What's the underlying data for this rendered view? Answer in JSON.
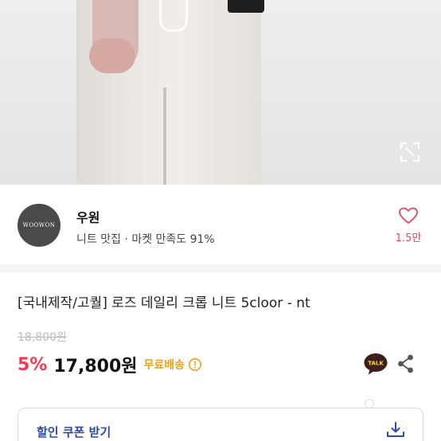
{
  "seller": {
    "avatar_text": "WOOWON",
    "name": "우원",
    "subtitle": "니트 맛집 · 마켓 만족도 91%",
    "like_count": "1.5만"
  },
  "product": {
    "title": "[국내제작/고퀄] 로즈 데일리 크롭 니트 5cloor - nt",
    "original_price": "18,800원",
    "discount": "5%",
    "price": "17,800원",
    "shipping": "무료배송"
  },
  "actions": {
    "talk_label": "TALK"
  },
  "coupon": {
    "label": "할인 쿠폰 받기"
  },
  "colors": {
    "accent_red": "#ef3c4f",
    "shipping_orange": "#e8a31a",
    "coupon_blue": "#2d4ba8"
  },
  "icons": [
    "expand-icon",
    "heart-icon",
    "info-icon",
    "kakao-talk-icon",
    "share-icon",
    "download-icon"
  ]
}
